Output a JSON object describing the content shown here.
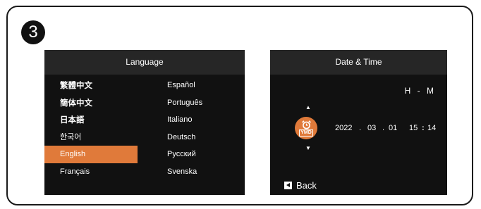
{
  "step": {
    "number": "3"
  },
  "language_screen": {
    "title": "Language",
    "left_column": [
      "繁體中文",
      "簡体中文",
      "日本語",
      "한국어",
      "English",
      "Français"
    ],
    "right_column": [
      "Español",
      "Português",
      "Italiano",
      "Deutsch",
      "Русский",
      "Svenska"
    ],
    "selected": "English"
  },
  "datetime_screen": {
    "title": "Date & Time",
    "field_label": "H - M",
    "badge_text": "YMD",
    "year": "2022",
    "month": "03",
    "day": "01",
    "separator": ".",
    "hour": "15",
    "minute": "14",
    "time_separator": ":",
    "back_label": "Back",
    "icons": {
      "up": "triangle-up-icon",
      "down": "triangle-down-icon",
      "badge": "clock-icon",
      "back": "back-icon"
    }
  },
  "colors": {
    "accent": "#e07a3a",
    "screen_bg": "#111111",
    "title_bar": "#262626"
  }
}
